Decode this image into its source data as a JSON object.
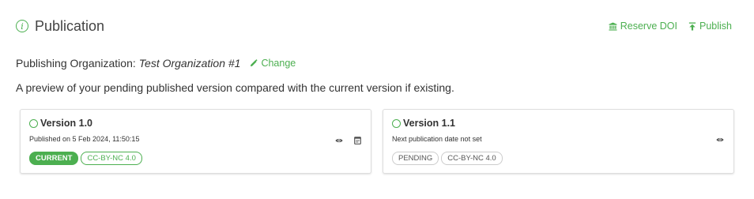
{
  "header": {
    "title": "Publication",
    "reserve_doi_label": "Reserve DOI",
    "publish_label": "Publish"
  },
  "organization": {
    "label": "Publishing Organization:",
    "name": "Test Organization #1",
    "change_label": "Change"
  },
  "preview_text": "A preview of your pending published version compared with the current version if existing.",
  "versions": [
    {
      "title": "Version 1.0",
      "subtitle": "Published on 5 Feb 2024, 11:50:15",
      "badges": [
        "CURRENT",
        "CC-BY-NC 4.0"
      ],
      "icons": [
        "eye-icon",
        "document-icon"
      ]
    },
    {
      "title": "Version 1.1",
      "subtitle": "Next publication date not set",
      "badges": [
        "PENDING",
        "CC-BY-NC 4.0"
      ],
      "icons": [
        "eye-icon"
      ]
    }
  ],
  "colors": {
    "accent": "#4caf50",
    "text": "#333333",
    "border": "#dedede"
  }
}
